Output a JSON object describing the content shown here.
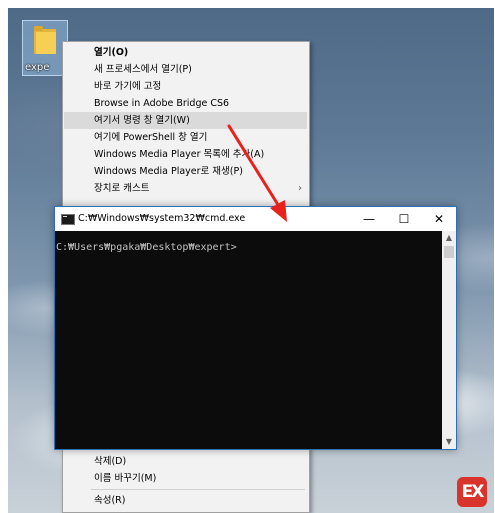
{
  "desktop": {
    "icon_label": "expe",
    "icon": "folder-icon"
  },
  "context_menu": {
    "items_top": [
      {
        "label": "열기(O)",
        "bold": true
      },
      {
        "label": "새 프로세스에서 열기(P)"
      },
      {
        "label": "바로 가기에 고정"
      },
      {
        "label": "Browse in Adobe Bridge CS6"
      },
      {
        "label": "여기서 명령 창 열기(W)",
        "highlighted": true
      },
      {
        "label": "여기에 PowerShell 창 열기"
      },
      {
        "label": "Windows Media Player 목록에 추가(A)"
      },
      {
        "label": "Windows Media Player로 재생(P)"
      },
      {
        "label": "장치로 캐스트",
        "has_submenu": true
      }
    ],
    "items_bottom": [
      {
        "label": "삭제(D)"
      },
      {
        "label": "이름 바꾸기(M)"
      },
      {
        "label": "속성(R)"
      }
    ]
  },
  "cmd_window": {
    "title": "C:₩Windows₩system32₩cmd.exe",
    "minimize": "—",
    "maximize": "☐",
    "close": "✕",
    "prompt": "C:₩Users₩pgaka₩Desktop₩expert>",
    "scroll_up": "▲",
    "scroll_down": "▼"
  },
  "annotation": {
    "arrow_color": "#e8221b"
  },
  "watermark": {
    "text": "EX",
    "color": "#d9342b"
  }
}
